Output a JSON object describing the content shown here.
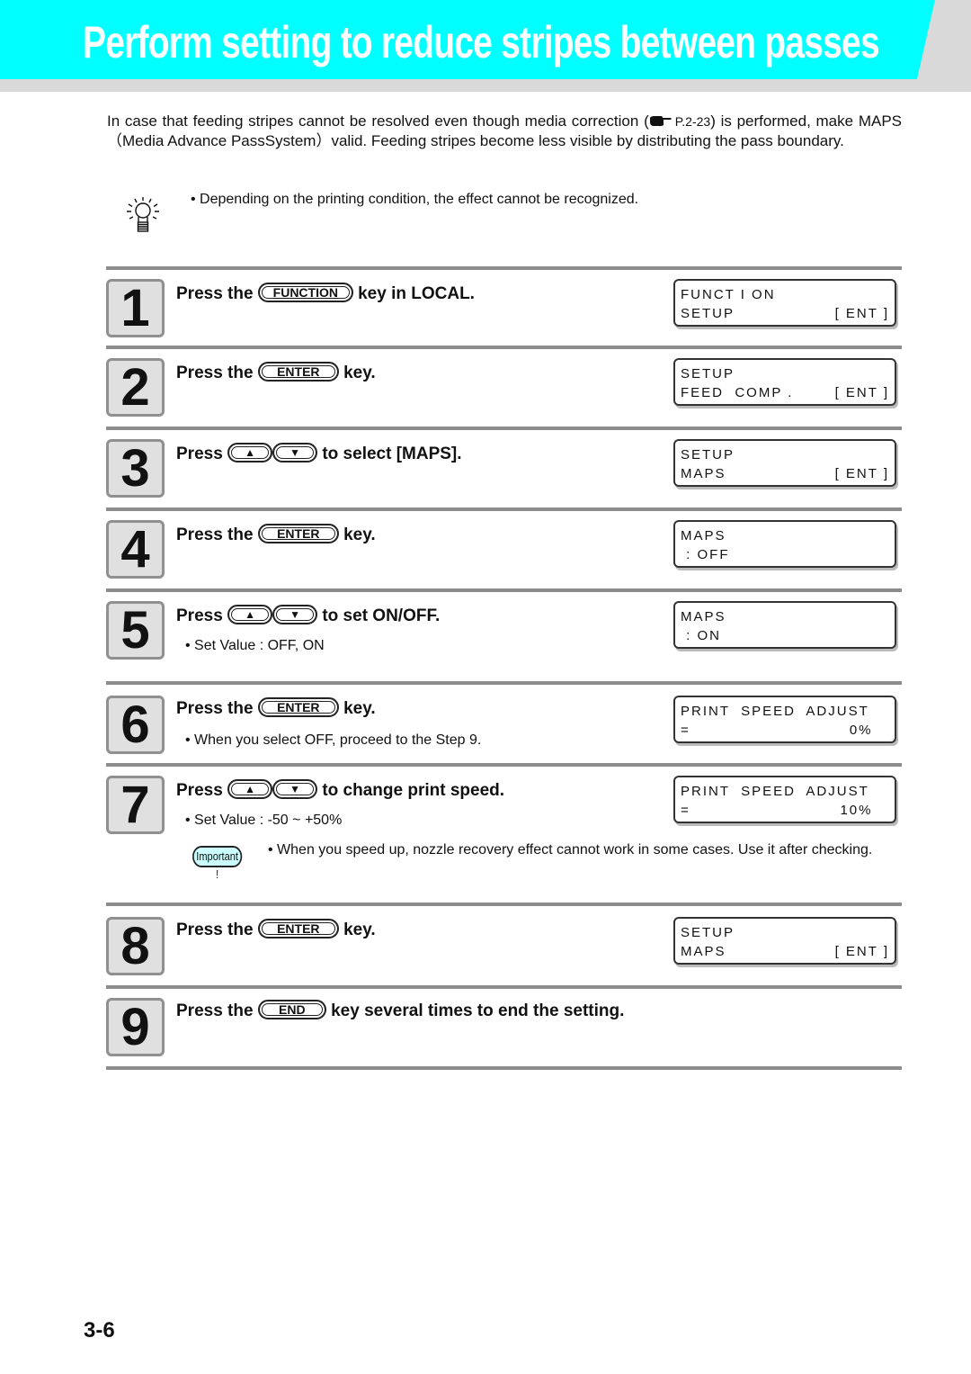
{
  "header": {
    "title": "Perform setting to reduce stripes between passes",
    "colors": {
      "banner": "#00ffff",
      "banner_shadow": "#d9d9d9",
      "title_text": "#ffffff"
    }
  },
  "intro": {
    "text_before_ref": "In case that feeding stripes cannot be resolved even though media correction (",
    "ref_icon": "pointing-hand-icon",
    "ref_page": "P.2-23",
    "text_after_ref": ") is performed, make MAPS（Media Advance PassSystem）valid. Feeding stripes become less visible by distributing the pass boundary."
  },
  "tip": {
    "icon": "lightbulb-icon",
    "text": "• Depending on the printing condition, the effect cannot be recognized."
  },
  "steps": [
    {
      "number": "1",
      "prefix": "Press the",
      "key": "FUNCTION",
      "suffix": "key in LOCAL.",
      "lcd": [
        [
          "FUNCT I ON",
          ""
        ],
        [
          "SETUP",
          "[ ENT ]"
        ]
      ]
    },
    {
      "number": "2",
      "prefix": "Press the",
      "key": "ENTER",
      "suffix": "key.",
      "lcd": [
        [
          "SETUP",
          ""
        ],
        [
          "FEED  COMP .",
          "[ ENT ]"
        ]
      ]
    },
    {
      "number": "3",
      "prefix": "Press",
      "keys": [
        "▲",
        "▼"
      ],
      "suffix": "to select [MAPS].",
      "lcd": [
        [
          "SETUP",
          ""
        ],
        [
          "MAPS",
          "[ ENT ]"
        ]
      ]
    },
    {
      "number": "4",
      "prefix": "Press the",
      "key": "ENTER",
      "suffix": "key.",
      "lcd": [
        [
          "MAPS",
          ""
        ],
        [
          " : OFF",
          ""
        ]
      ]
    },
    {
      "number": "5",
      "prefix": "Press",
      "keys": [
        "▲",
        "▼"
      ],
      "suffix": "to set ON/OFF.",
      "note": "• Set Value : OFF, ON",
      "lcd": [
        [
          "MAPS",
          ""
        ],
        [
          " : ON",
          ""
        ]
      ]
    },
    {
      "number": "6",
      "prefix": "Press the",
      "key": "ENTER",
      "suffix": "key.",
      "note": "• When you select OFF, proceed to the Step 9.",
      "lcd": [
        [
          "PRINT  SPEED  ADJUST",
          ""
        ],
        [
          "=",
          "0%   "
        ]
      ]
    },
    {
      "number": "7",
      "prefix": "Press",
      "keys": [
        "▲",
        "▼"
      ],
      "suffix": "to change print speed.",
      "note": "• Set Value : -50 ~ +50%",
      "lcd": [
        [
          "PRINT  SPEED  ADJUST",
          ""
        ],
        [
          "=",
          "10%   "
        ]
      ],
      "important": {
        "badge": "Important !",
        "text": "When you speed up, nozzle recovery effect cannot work in some cases. Use it after checking."
      }
    },
    {
      "number": "8",
      "prefix": "Press the",
      "key": "ENTER",
      "suffix": "key.",
      "lcd": [
        [
          "SETUP",
          ""
        ],
        [
          "MAPS",
          "[ ENT ]"
        ]
      ]
    },
    {
      "number": "9",
      "prefix": "Press the",
      "key": "END",
      "suffix": "key several times to end the setting."
    }
  ],
  "footer": {
    "page_number": "3-6"
  }
}
